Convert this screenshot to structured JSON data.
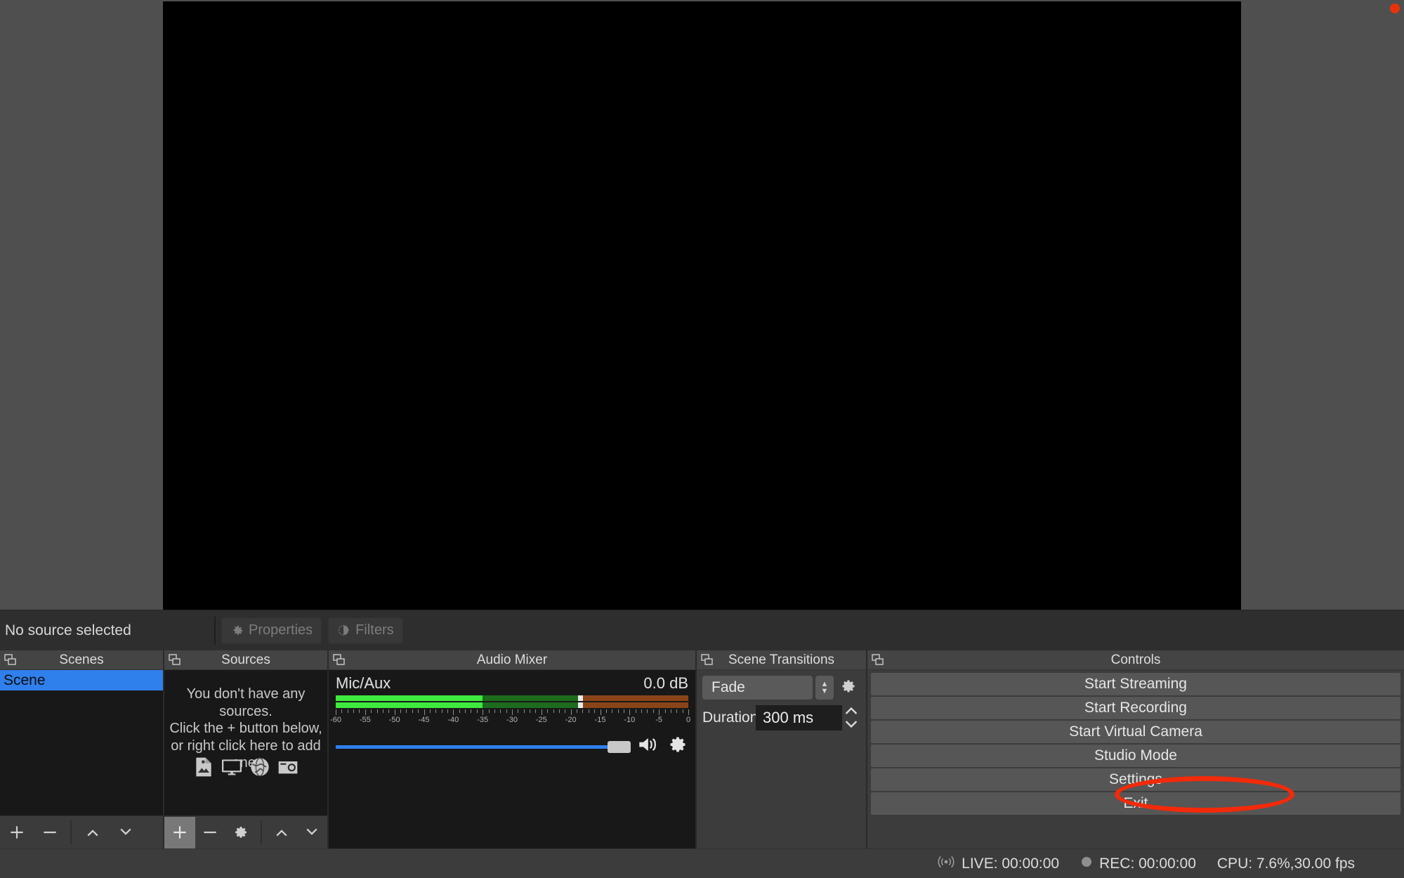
{
  "source_toolbar": {
    "status_label": "No source selected",
    "buttons": [
      {
        "label": "Properties",
        "icon": "gear-icon",
        "disabled": true
      },
      {
        "label": "Filters",
        "icon": "filters-icon",
        "disabled": true
      }
    ]
  },
  "docks": {
    "scenes": {
      "title": "Scenes",
      "float_icon": "undock-icon",
      "items": [
        {
          "label": "Scene",
          "selected": true
        }
      ],
      "toolbar": [
        {
          "name": "add-scene-button",
          "icon": "plus-icon"
        },
        {
          "name": "remove-scene-button",
          "icon": "minus-icon"
        },
        {
          "name": "move-scene-up-button",
          "icon": "chevron-up-icon"
        },
        {
          "name": "move-scene-down-button",
          "icon": "chevron-down-icon"
        }
      ]
    },
    "sources": {
      "title": "Sources",
      "float_icon": "undock-icon",
      "empty_lines": [
        "You don't have any sources.",
        "Click the + button below,",
        "or right click here to add one."
      ],
      "empty_icons": [
        "image-icon",
        "display-icon",
        "browser-icon",
        "camera-icon"
      ],
      "toolbar": [
        {
          "name": "add-source-button",
          "icon": "plus-icon",
          "highlighted": true
        },
        {
          "name": "remove-source-button",
          "icon": "minus-icon"
        },
        {
          "name": "source-properties-button",
          "icon": "gear-icon"
        },
        {
          "name": "move-source-up-button",
          "icon": "chevron-up-icon"
        },
        {
          "name": "move-source-down-button",
          "icon": "chevron-down-icon"
        }
      ]
    },
    "audio_mixer": {
      "title": "Audio Mixer",
      "float_icon": "undock-icon",
      "channels": [
        {
          "name": "Mic/Aux",
          "db": "0.0 dB",
          "meter": {
            "min_db": -60,
            "max_db": 0,
            "magnitude_db": -35,
            "peak_db": -18.5,
            "input_peak_db": -9,
            "colors": {
              "green": "#3eea3e",
              "dark_green": "#1d6b1d",
              "brown": "#8a4418"
            }
          },
          "volume_percent": 100,
          "mute_icon": "speaker-icon",
          "config_icon": "gear-icon"
        }
      ],
      "tick_labels": [
        "-60",
        "-55",
        "-50",
        "-45",
        "-40",
        "-35",
        "-30",
        "-25",
        "-20",
        "-15",
        "-10",
        "-5",
        "0"
      ]
    },
    "scene_transitions": {
      "title": "Scene Transitions",
      "float_icon": "undock-icon",
      "transition_value": "Fade",
      "transition_options": [
        "Fade"
      ],
      "config_icon": "gear-icon",
      "duration_label": "Duration",
      "duration_value": "300 ms"
    },
    "controls": {
      "title": "Controls",
      "float_icon": "undock-icon",
      "buttons": [
        {
          "label": "Start Streaming",
          "highlighted": false
        },
        {
          "label": "Start Recording",
          "highlighted": false
        },
        {
          "label": "Start Virtual Camera",
          "highlighted": false
        },
        {
          "label": "Studio Mode",
          "highlighted": false
        },
        {
          "label": "Settings",
          "highlighted": true
        },
        {
          "label": "Exit",
          "highlighted": false
        }
      ]
    }
  },
  "annotation": {
    "shape": "ellipse",
    "color": "#f32a0a",
    "targets": "Settings"
  },
  "status_bar": {
    "live_icon": "broadcast-icon",
    "live": "LIVE: 00:00:00",
    "rec_icon": "record-dot-icon",
    "rec": "REC: 00:00:00",
    "cpu": "CPU: 7.6%,30.00 fps"
  }
}
